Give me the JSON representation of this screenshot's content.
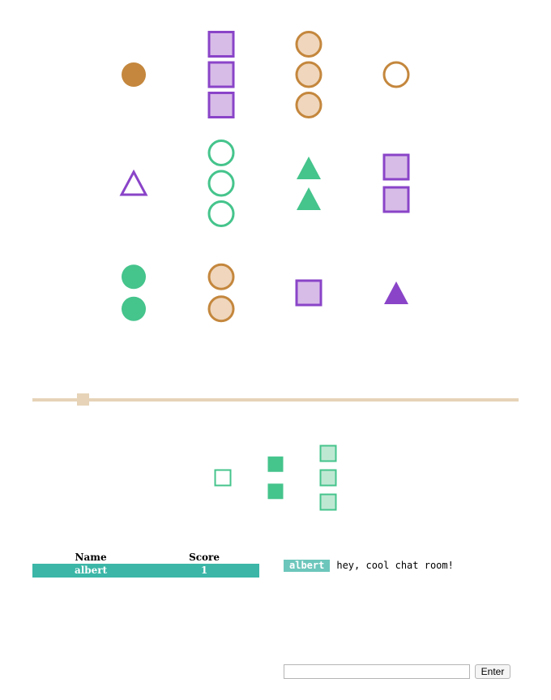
{
  "colors": {
    "purple": "#8a44c8",
    "green": "#45c48c",
    "orange": "#c4873d",
    "purple_fill_light": "#d8bce8",
    "orange_fill_light": "#efd6bd",
    "green_fill_light": "#bfe8d3",
    "slider": "#e6d3b8",
    "table_row": "#3bb6a7",
    "chat_user_bg": "#6cc6bb"
  },
  "board": {
    "cards": [
      {
        "shape": "circle",
        "color": "orange",
        "fill": "solid",
        "count": 1
      },
      {
        "shape": "square",
        "color": "purple",
        "fill": "light",
        "count": 3
      },
      {
        "shape": "circle",
        "color": "orange",
        "fill": "light",
        "count": 3
      },
      {
        "shape": "circle",
        "color": "orange",
        "fill": "outline",
        "count": 1
      },
      {
        "shape": "triangle",
        "color": "purple",
        "fill": "outline",
        "count": 1
      },
      {
        "shape": "circle",
        "color": "green",
        "fill": "outline",
        "count": 3
      },
      {
        "shape": "triangle",
        "color": "green",
        "fill": "solid",
        "count": 2
      },
      {
        "shape": "square",
        "color": "purple",
        "fill": "light",
        "count": 2
      },
      {
        "shape": "circle",
        "color": "green",
        "fill": "solid",
        "count": 2
      },
      {
        "shape": "circle",
        "color": "orange",
        "fill": "light",
        "count": 2
      },
      {
        "shape": "square",
        "color": "purple",
        "fill": "light",
        "count": 1
      },
      {
        "shape": "triangle",
        "color": "purple",
        "fill": "solid",
        "count": 1
      }
    ]
  },
  "slider": {
    "value": 0.1
  },
  "selected": {
    "cards": [
      {
        "shape": "small-square",
        "color": "green",
        "fill": "outline",
        "count": 1
      },
      {
        "shape": "small-square",
        "color": "green",
        "fill": "solid",
        "count": 2
      },
      {
        "shape": "small-square",
        "color": "green",
        "fill": "light",
        "count": 3
      }
    ]
  },
  "scoreboard": {
    "headers": {
      "name": "Name",
      "score": "Score"
    },
    "rows": [
      {
        "name": "albert",
        "score": "1"
      }
    ]
  },
  "chat": {
    "messages": [
      {
        "user": "albert",
        "text": "hey, cool chat room!"
      }
    ],
    "input_value": "",
    "enter_label": "Enter"
  }
}
